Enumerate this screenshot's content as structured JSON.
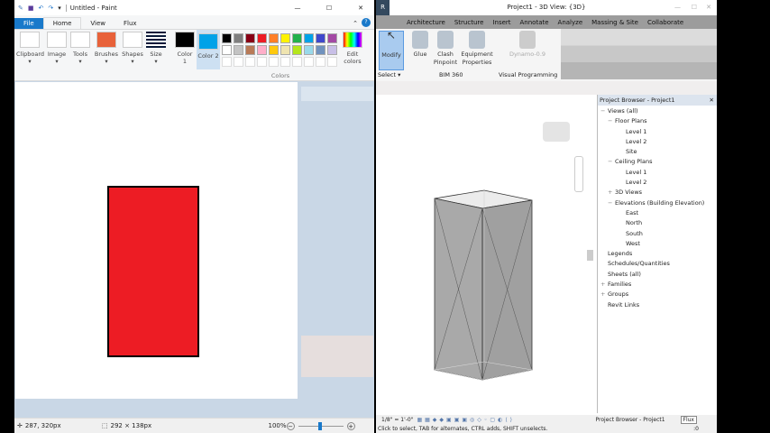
{
  "paint": {
    "title": "Untitled - Paint",
    "tabs": [
      "File",
      "Home",
      "View",
      "Flux"
    ],
    "tools": [
      "Clipboard",
      "Image",
      "Tools",
      "Brushes",
      "Shapes",
      "Size"
    ],
    "color1": "Color 1",
    "color2": "Color 2",
    "colors_group": "Colors",
    "edit_colors": "Edit colors",
    "palette_row1": [
      "#000000",
      "#7f7f7f",
      "#880015",
      "#ed1c24",
      "#ff7f27",
      "#fff200",
      "#22b14c",
      "#00a2e8",
      "#3f48cc",
      "#a349a4"
    ],
    "palette_row2": [
      "#ffffff",
      "#c3c3c3",
      "#b97a57",
      "#ffaec9",
      "#ffc90e",
      "#efe4b0",
      "#b5e61d",
      "#99d9ea",
      "#7092be",
      "#c8bfe7"
    ],
    "color1_value": "#000000",
    "color2_value": "#00a2e8",
    "shape_fill": "#ed1c24",
    "status": {
      "cursor": "287, 320px",
      "selection": "292 × 138px",
      "zoom": "100%",
      "zoom_percent": 100
    }
  },
  "revit": {
    "title": "Project1 - 3D View: {3D}",
    "tabs": [
      "Architecture",
      "Structure",
      "Insert",
      "Annotate",
      "Analyze",
      "Massing & Site",
      "Collaborate"
    ],
    "buttons": [
      {
        "label": "Modify"
      },
      {
        "label": "Glue"
      },
      {
        "label": "Clash Pinpoint"
      },
      {
        "label": "Equipment Properties"
      },
      {
        "label": "Dynamo-0.9"
      }
    ],
    "groups": [
      "Select ▾",
      "BIM 360",
      "Visual Programming"
    ],
    "browser_title": "Project Browser - Project1",
    "tree": [
      {
        "label": "Views (all)",
        "level": 0,
        "toggle": "−"
      },
      {
        "label": "Floor Plans",
        "level": 1,
        "toggle": "−"
      },
      {
        "label": "Level 1",
        "level": 2
      },
      {
        "label": "Level 2",
        "level": 2
      },
      {
        "label": "Site",
        "level": 2
      },
      {
        "label": "Ceiling Plans",
        "level": 1,
        "toggle": "−"
      },
      {
        "label": "Level 1",
        "level": 2
      },
      {
        "label": "Level 2",
        "level": 2
      },
      {
        "label": "3D Views",
        "level": 1,
        "toggle": "+"
      },
      {
        "label": "Elevations (Building Elevation)",
        "level": 1,
        "toggle": "−"
      },
      {
        "label": "East",
        "level": 2
      },
      {
        "label": "North",
        "level": 2
      },
      {
        "label": "South",
        "level": 2
      },
      {
        "label": "West",
        "level": 2
      },
      {
        "label": "Legends",
        "level": 0
      },
      {
        "label": "Schedules/Quantities",
        "level": 0
      },
      {
        "label": "Sheets (all)",
        "level": 0
      },
      {
        "label": "Families",
        "level": 0,
        "toggle": "+"
      },
      {
        "label": "Groups",
        "level": 0,
        "toggle": "+"
      },
      {
        "label": "Revit Links",
        "level": 0
      }
    ],
    "scale": "1/8\" = 1'-0\"",
    "bottom_tabs": [
      "Project Browser - Project1",
      "Flux"
    ],
    "status": "Click to select, TAB for alternates, CTRL adds, SHIFT unselects.",
    "status_right": ":0"
  }
}
